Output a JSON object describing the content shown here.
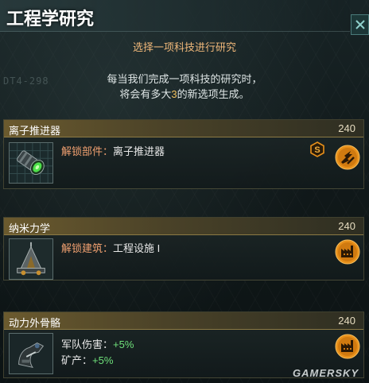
{
  "window": {
    "title": "工程学研究",
    "close_icon": "close-icon"
  },
  "background_text": "DT4-298",
  "subtitle": "选择一项科技进行研究",
  "description": {
    "line1": "每当我们完成一项科技的研究时，",
    "line2_prefix": "将会有多大",
    "line2_number": "3",
    "line2_suffix": "的新选项生成。"
  },
  "techs": [
    {
      "name": "离子推进器",
      "cost": "240",
      "effects": [
        {
          "label": "解锁部件：",
          "value": "离子推进器"
        }
      ],
      "badge": "S",
      "category_icon": "propulsion-icon"
    },
    {
      "name": "纳米力学",
      "cost": "240",
      "effects": [
        {
          "label": "解锁建筑：",
          "value": "工程设施 I"
        }
      ],
      "category_icon": "industry-icon"
    },
    {
      "name": "动力外骨骼",
      "cost": "240",
      "effects": [
        {
          "label": "军队伤害：",
          "value": "+5%"
        },
        {
          "label": "矿产：",
          "value": "+5%"
        }
      ],
      "category_icon": "industry-icon"
    }
  ],
  "watermark": "GAMERSKY",
  "colors": {
    "accent_orange": "#f0a070",
    "positive_green": "#6fe07a",
    "card_header": "#6b5a2e",
    "icon_orange": "#e8901a"
  }
}
